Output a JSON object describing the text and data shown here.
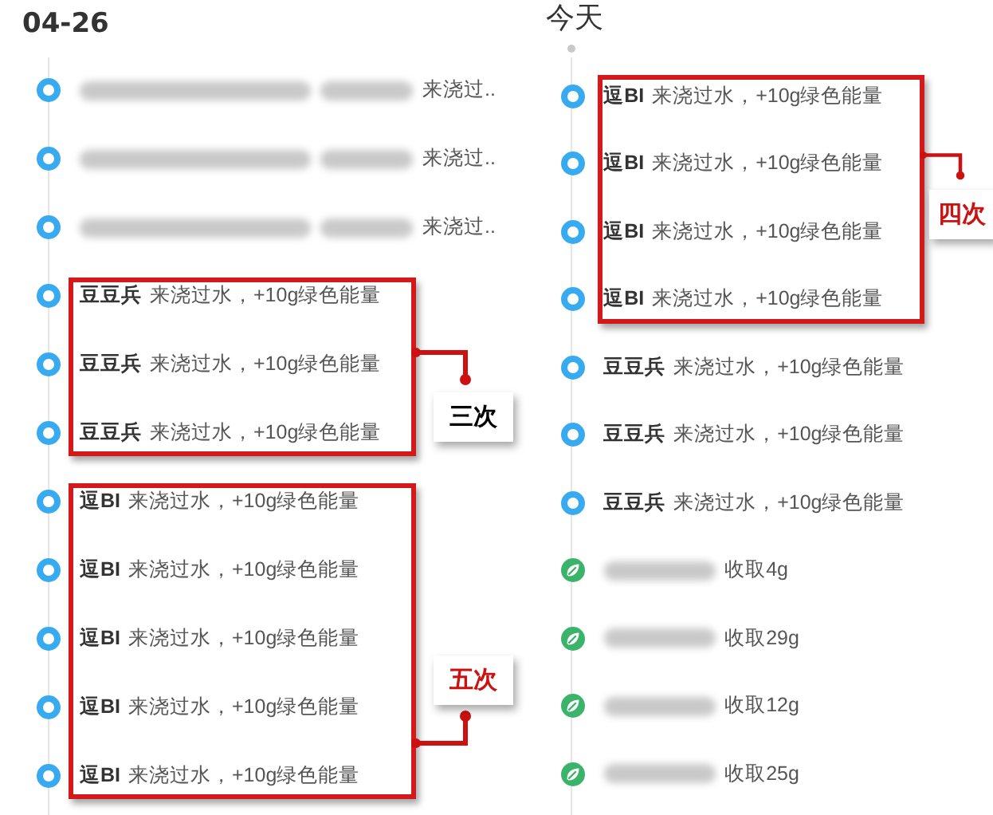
{
  "columns": [
    {
      "heading": "04-26",
      "groups": [
        {
          "items": [
            {
              "kind": "watering",
              "redacted": true,
              "text": "来浇过.."
            },
            {
              "kind": "watering",
              "redacted": true,
              "text": "来浇过.."
            },
            {
              "kind": "watering",
              "redacted": true,
              "text": "来浇过.."
            }
          ]
        },
        {
          "annotation": {
            "label": "三次",
            "color": "#000000"
          },
          "items": [
            {
              "kind": "watering",
              "name": "豆豆兵",
              "text": "来浇过水，+10g绿色能量"
            },
            {
              "kind": "watering",
              "name": "豆豆兵",
              "text": "来浇过水，+10g绿色能量"
            },
            {
              "kind": "watering",
              "name": "豆豆兵",
              "text": "来浇过水，+10g绿色能量"
            }
          ]
        },
        {
          "annotation": {
            "label": "五次",
            "color": "#cc1111"
          },
          "items": [
            {
              "kind": "watering",
              "name": "逗BI",
              "text": "来浇过水，+10g绿色能量"
            },
            {
              "kind": "watering",
              "name": "逗BI",
              "text": "来浇过水，+10g绿色能量"
            },
            {
              "kind": "watering",
              "name": "逗BI",
              "text": "来浇过水，+10g绿色能量"
            },
            {
              "kind": "watering",
              "name": "逗BI",
              "text": "来浇过水，+10g绿色能量"
            },
            {
              "kind": "watering",
              "name": "逗BI",
              "text": "来浇过水，+10g绿色能量"
            }
          ]
        }
      ]
    },
    {
      "heading": "今天",
      "groups": [
        {
          "annotation": {
            "label": "四次",
            "color": "#cc1111"
          },
          "items": [
            {
              "kind": "watering",
              "name": "逗BI",
              "text": "来浇过水，+10g绿色能量"
            },
            {
              "kind": "watering",
              "name": "逗BI",
              "text": "来浇过水，+10g绿色能量"
            },
            {
              "kind": "watering",
              "name": "逗BI",
              "text": "来浇过水，+10g绿色能量"
            },
            {
              "kind": "watering",
              "name": "逗BI",
              "text": "来浇过水，+10g绿色能量"
            }
          ]
        },
        {
          "items": [
            {
              "kind": "watering",
              "name": "豆豆兵",
              "text": "来浇过水，+10g绿色能量"
            },
            {
              "kind": "watering",
              "name": "豆豆兵",
              "text": "来浇过水，+10g绿色能量"
            },
            {
              "kind": "watering",
              "name": "豆豆兵",
              "text": "来浇过水，+10g绿色能量"
            },
            {
              "kind": "collect",
              "redacted": true,
              "text": "收取4g"
            },
            {
              "kind": "collect",
              "redacted": true,
              "text": "收取29g"
            },
            {
              "kind": "collect",
              "redacted": true,
              "text": "收取12g"
            },
            {
              "kind": "collect",
              "redacted": true,
              "text": "收取25g"
            }
          ]
        }
      ]
    }
  ]
}
